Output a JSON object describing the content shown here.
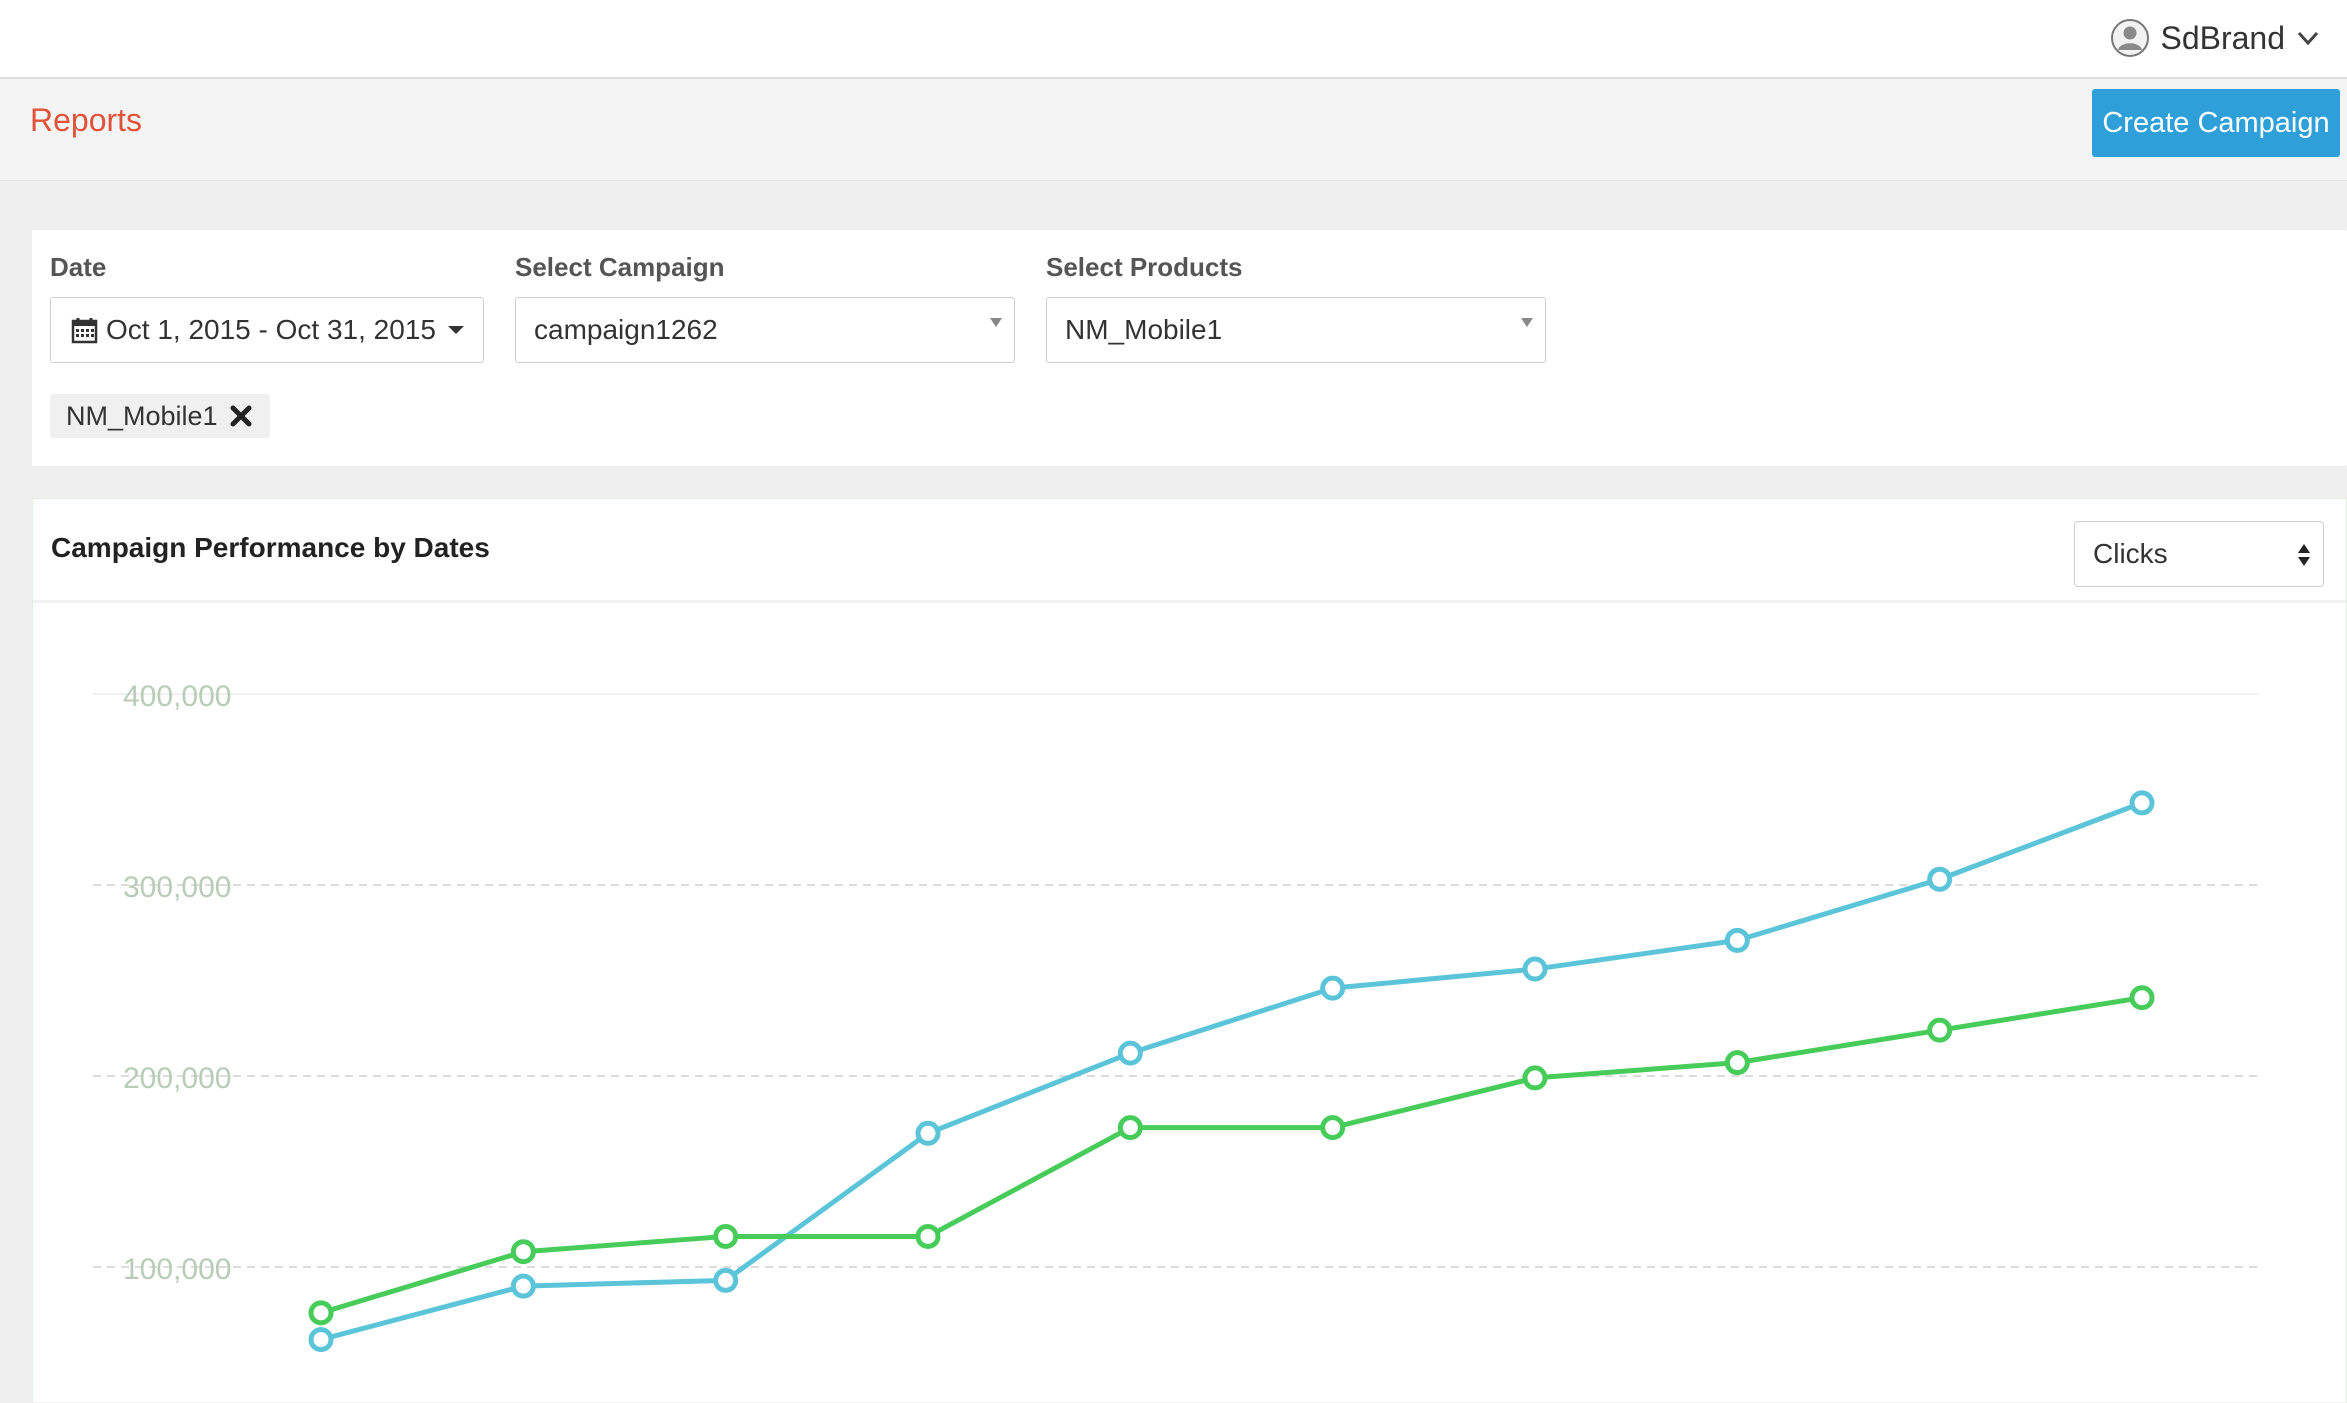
{
  "header": {
    "user_name": "SdBrand",
    "avatar_icon": "user-avatar-icon",
    "menu_icon": "chevron-down-icon"
  },
  "subheader": {
    "title": "Reports",
    "create_button": "Create Campaign"
  },
  "filters": {
    "date_label": "Date",
    "date_range": "Oct 1, 2015 - Oct 31, 2015",
    "campaign_label": "Select Campaign",
    "campaign_value": "campaign1262",
    "products_label": "Select Products",
    "products_value": "NM_Mobile1",
    "selected_tags": [
      "NM_Mobile1"
    ]
  },
  "chart_panel": {
    "title": "Campaign Performance by Dates",
    "metric_selected": "Clicks"
  },
  "colors": {
    "accent": "#2e9fd8",
    "title_red": "#e0533a",
    "series_blue": "#5bc4d9",
    "series_green": "#47cc5a"
  },
  "chart_data": {
    "type": "line",
    "title": "",
    "xlabel": "",
    "ylabel": "",
    "ylim": [
      55000,
      420000
    ],
    "yticks": [
      100000,
      200000,
      300000,
      400000
    ],
    "ytick_labels": [
      "100,000",
      "200,000",
      "300,000",
      "400,000"
    ],
    "x": [
      1,
      2,
      3,
      4,
      5,
      6,
      7,
      8,
      9,
      10
    ],
    "grid": true,
    "series": [
      {
        "color": "#5bc4d9",
        "values": [
          62000,
          90000,
          93000,
          170000,
          212000,
          246000,
          256000,
          271000,
          303000,
          343000
        ]
      },
      {
        "color": "#47cc5a",
        "values": [
          76000,
          108000,
          116000,
          116000,
          173000,
          173000,
          199000,
          207000,
          224000,
          241000
        ]
      }
    ]
  }
}
